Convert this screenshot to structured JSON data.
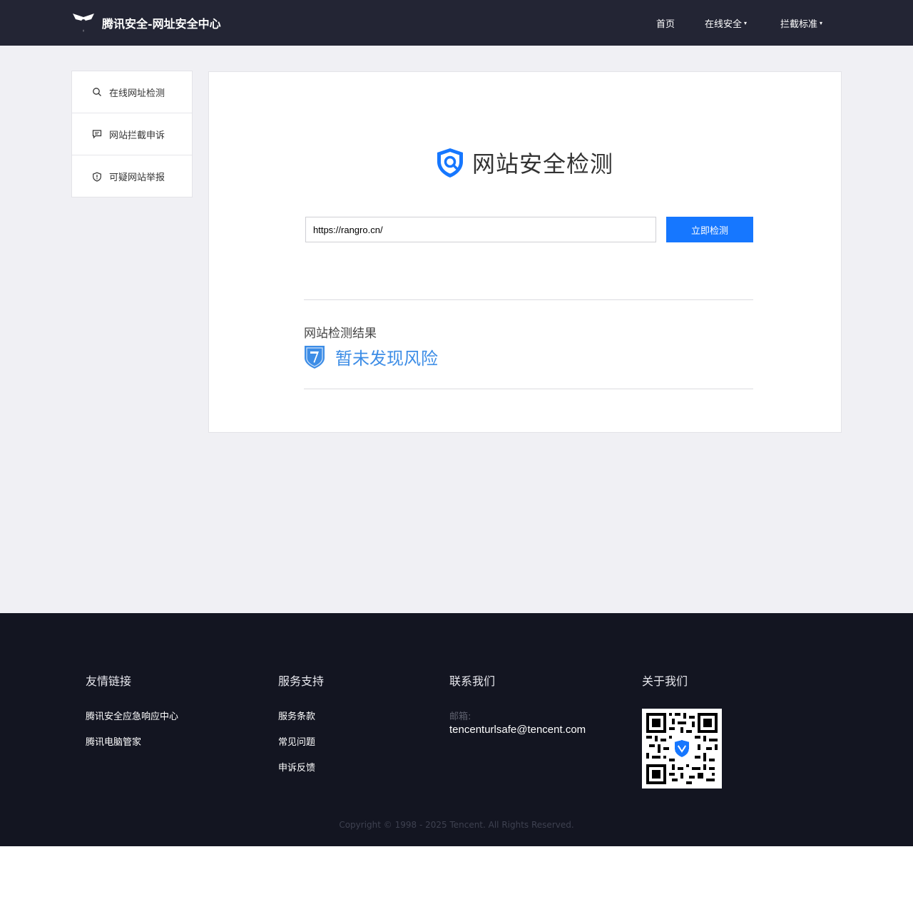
{
  "header": {
    "brand": "腾讯安全-网址安全中心",
    "nav": [
      {
        "label": "首页",
        "caret": ""
      },
      {
        "label": "在线安全",
        "caret": "▾"
      },
      {
        "label": "拦截标准",
        "caret": "▾"
      }
    ]
  },
  "sidebar": {
    "items": [
      {
        "label": "在线网址检测",
        "icon": "search-icon"
      },
      {
        "label": "网站拦截申诉",
        "icon": "chat-icon"
      },
      {
        "label": "可疑网站举报",
        "icon": "shield-alert-icon"
      }
    ]
  },
  "main": {
    "title": "网站安全检测",
    "url_value": "https://rangro.cn/",
    "check_button": "立即检测",
    "result_label": "网站检测结果",
    "result_status": "暂未发现风险"
  },
  "footer": {
    "columns": {
      "links": {
        "title": "友情链接",
        "items": [
          "腾讯安全应急响应中心",
          "腾讯电脑管家"
        ]
      },
      "support": {
        "title": "服务支持",
        "items": [
          "服务条款",
          "常见问题",
          "申诉反馈"
        ]
      },
      "contact": {
        "title": "联系我们",
        "email_label": "邮箱:",
        "email": "tencenturlsafe@tencent.com"
      },
      "about": {
        "title": "关于我们"
      }
    },
    "copyright": "Copyright © 1998 - 2025 Tencent. All Rights Reserved."
  },
  "colors": {
    "header_bg": "#232534",
    "page_bg": "#f0f0f4",
    "accent": "#1677ff",
    "result_blue": "#3d8de6",
    "footer_bg": "#131521"
  }
}
